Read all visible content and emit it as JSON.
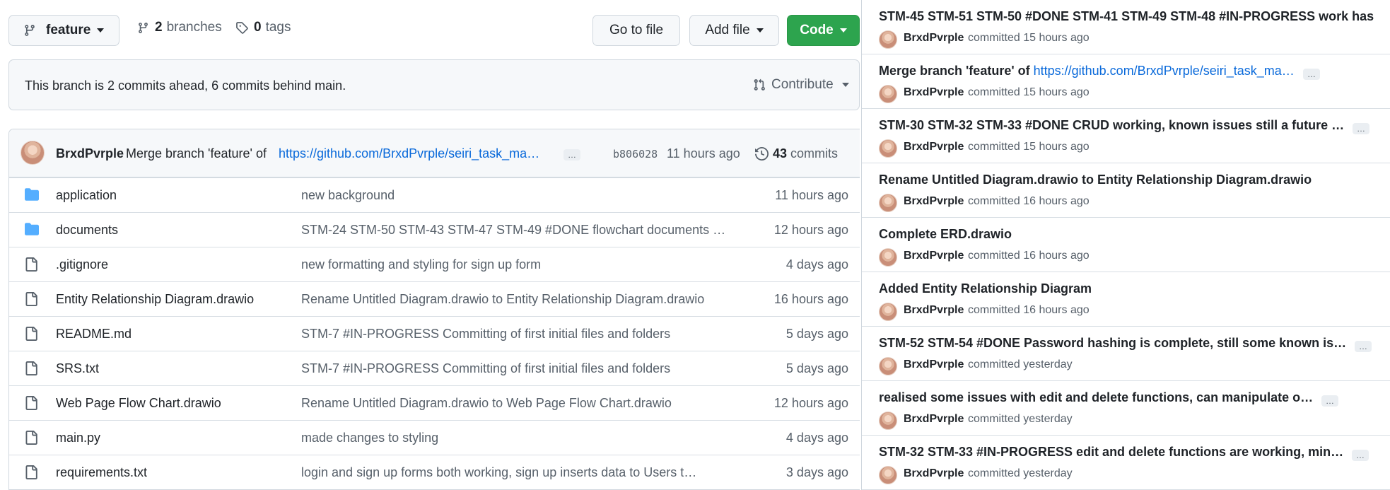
{
  "toolbar": {
    "branch": "feature",
    "branches_count": "2",
    "branches_label": "branches",
    "tags_count": "0",
    "tags_label": "tags",
    "goto_file": "Go to file",
    "add_file": "Add file",
    "code": "Code"
  },
  "branch_status": {
    "text": "This branch is 2 commits ahead, 6 commits behind main.",
    "contribute": "Contribute"
  },
  "latest_commit": {
    "author": "BrxdPvrple",
    "message": "Merge branch 'feature' of",
    "url": "https://github.com/BrxdPvrple/seiri_task_ma…",
    "ellipsis": "…",
    "sha": "b806028",
    "time": "11 hours ago",
    "count": "43",
    "count_label": "commits"
  },
  "files": [
    {
      "type": "folder",
      "name": "application",
      "message": "new background",
      "time": "11 hours ago"
    },
    {
      "type": "folder",
      "name": "documents",
      "message": "STM-24 STM-50 STM-43 STM-47 STM-49 #DONE flowchart documents …",
      "time": "12 hours ago"
    },
    {
      "type": "file",
      "name": ".gitignore",
      "message": "new formatting and styling for sign up form",
      "time": "4 days ago"
    },
    {
      "type": "file",
      "name": "Entity Relationship Diagram.drawio",
      "message": "Rename Untitled Diagram.drawio to Entity Relationship Diagram.drawio",
      "time": "16 hours ago"
    },
    {
      "type": "file",
      "name": "README.md",
      "message": "STM-7 #IN-PROGRESS Committing of first initial files and folders",
      "time": "5 days ago"
    },
    {
      "type": "file",
      "name": "SRS.txt",
      "message": "STM-7 #IN-PROGRESS Committing of first initial files and folders",
      "time": "5 days ago"
    },
    {
      "type": "file",
      "name": "Web Page Flow Chart.drawio",
      "message": "Rename Untitled Diagram.drawio to Web Page Flow Chart.drawio",
      "time": "12 hours ago"
    },
    {
      "type": "file",
      "name": "main.py",
      "message": "made changes to styling",
      "time": "4 days ago"
    },
    {
      "type": "file",
      "name": "requirements.txt",
      "message": "login and sign up forms both working, sign up inserts data to Users t…",
      "time": "3 days ago"
    }
  ],
  "commits": [
    {
      "title": "STM-45 STM-51 STM-50 #DONE STM-41 STM-49 STM-48 #IN-PROGRESS work has",
      "link": "",
      "more": false,
      "author": "BrxdPvrple",
      "meta": "committed 15 hours ago"
    },
    {
      "title": "Merge branch 'feature' of ",
      "link": "https://github.com/BrxdPvrple/seiri_task_ma…",
      "more": true,
      "author": "BrxdPvrple",
      "meta": "committed 15 hours ago"
    },
    {
      "title": "STM-30 STM-32 STM-33 #DONE CRUD working, known issues still a future …",
      "link": "",
      "more": true,
      "author": "BrxdPvrple",
      "meta": "committed 15 hours ago"
    },
    {
      "title": "Rename Untitled Diagram.drawio to Entity Relationship Diagram.drawio",
      "link": "",
      "more": false,
      "author": "BrxdPvrple",
      "meta": "committed 16 hours ago"
    },
    {
      "title": "Complete ERD.drawio",
      "link": "",
      "more": false,
      "author": "BrxdPvrple",
      "meta": "committed 16 hours ago"
    },
    {
      "title": "Added Entity Relationship Diagram",
      "link": "",
      "more": false,
      "author": "BrxdPvrple",
      "meta": "committed 16 hours ago"
    },
    {
      "title": "STM-52 STM-54 #DONE Password hashing is complete, still some known is…",
      "link": "",
      "more": true,
      "author": "BrxdPvrple",
      "meta": "committed yesterday"
    },
    {
      "title": "realised some issues with edit and delete functions, can manipulate o…",
      "link": "",
      "more": true,
      "author": "BrxdPvrple",
      "meta": "committed yesterday"
    },
    {
      "title": "STM-32 STM-33 #IN-PROGRESS edit and delete functions are working, min…",
      "link": "",
      "more": true,
      "author": "BrxdPvrple",
      "meta": "committed yesterday"
    }
  ],
  "colors": {
    "accent": "#0969da",
    "code_button": "#2da44e",
    "folder": "#54aeff"
  }
}
